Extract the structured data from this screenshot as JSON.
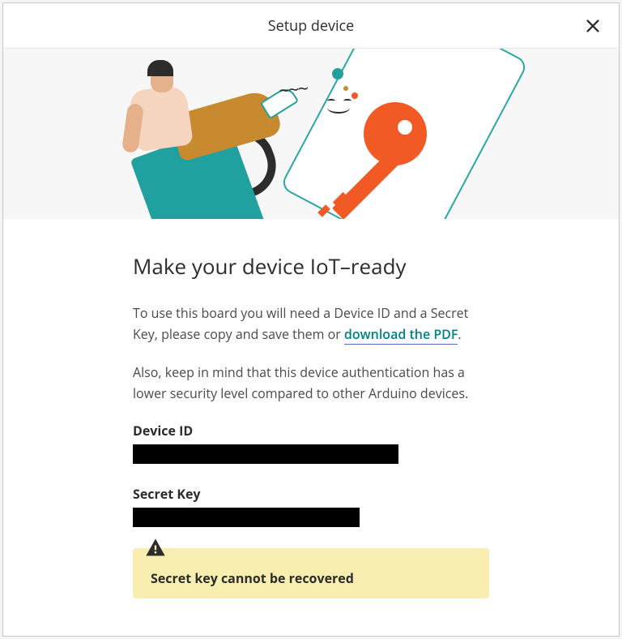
{
  "modal": {
    "title": "Setup device"
  },
  "page": {
    "heading": "Make your device IoT–ready",
    "intro_before_link": "To use this board you will need a Device ID and a Secret Key, please copy and save them or ",
    "intro_link": "download the PDF",
    "intro_after_link": ".",
    "security_note": "Also, keep in mind that this device authentication has a lower security level compared to other Arduino devices.",
    "device_id_label": "Device ID",
    "device_id_value": "████████████████████████████████",
    "secret_key_label": "Secret Key",
    "secret_key_value": "████████████████████████████",
    "warning_title": "Secret key cannot be recovered"
  }
}
